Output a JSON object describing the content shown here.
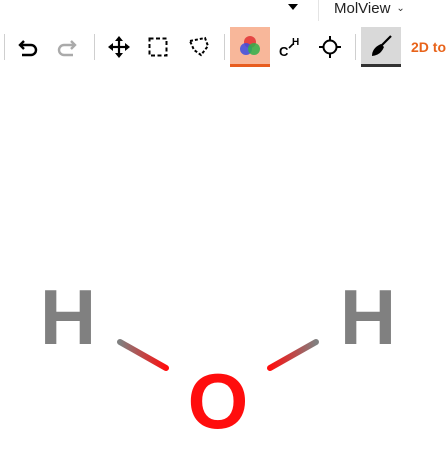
{
  "topbar": {
    "menu_label": "MolView",
    "menu_caret": "⌄"
  },
  "toolbar": {
    "undo": "undo-icon",
    "redo": "redo-icon",
    "move": "move-icon",
    "rect_select": "rect-select-icon",
    "lasso_select": "lasso-select-icon",
    "color_mode": "color-mode-icon",
    "skeletal": "skeletal-icon",
    "center": "crosshair-icon",
    "eraser": "eraser-icon",
    "tab_2d_label": "2D to",
    "accent_color": "#e85d1f"
  },
  "molecule": {
    "atoms": [
      {
        "symbol": "H",
        "color": "#808080"
      },
      {
        "symbol": "O",
        "color": "#ff0d0d"
      },
      {
        "symbol": "H",
        "color": "#808080"
      }
    ]
  }
}
